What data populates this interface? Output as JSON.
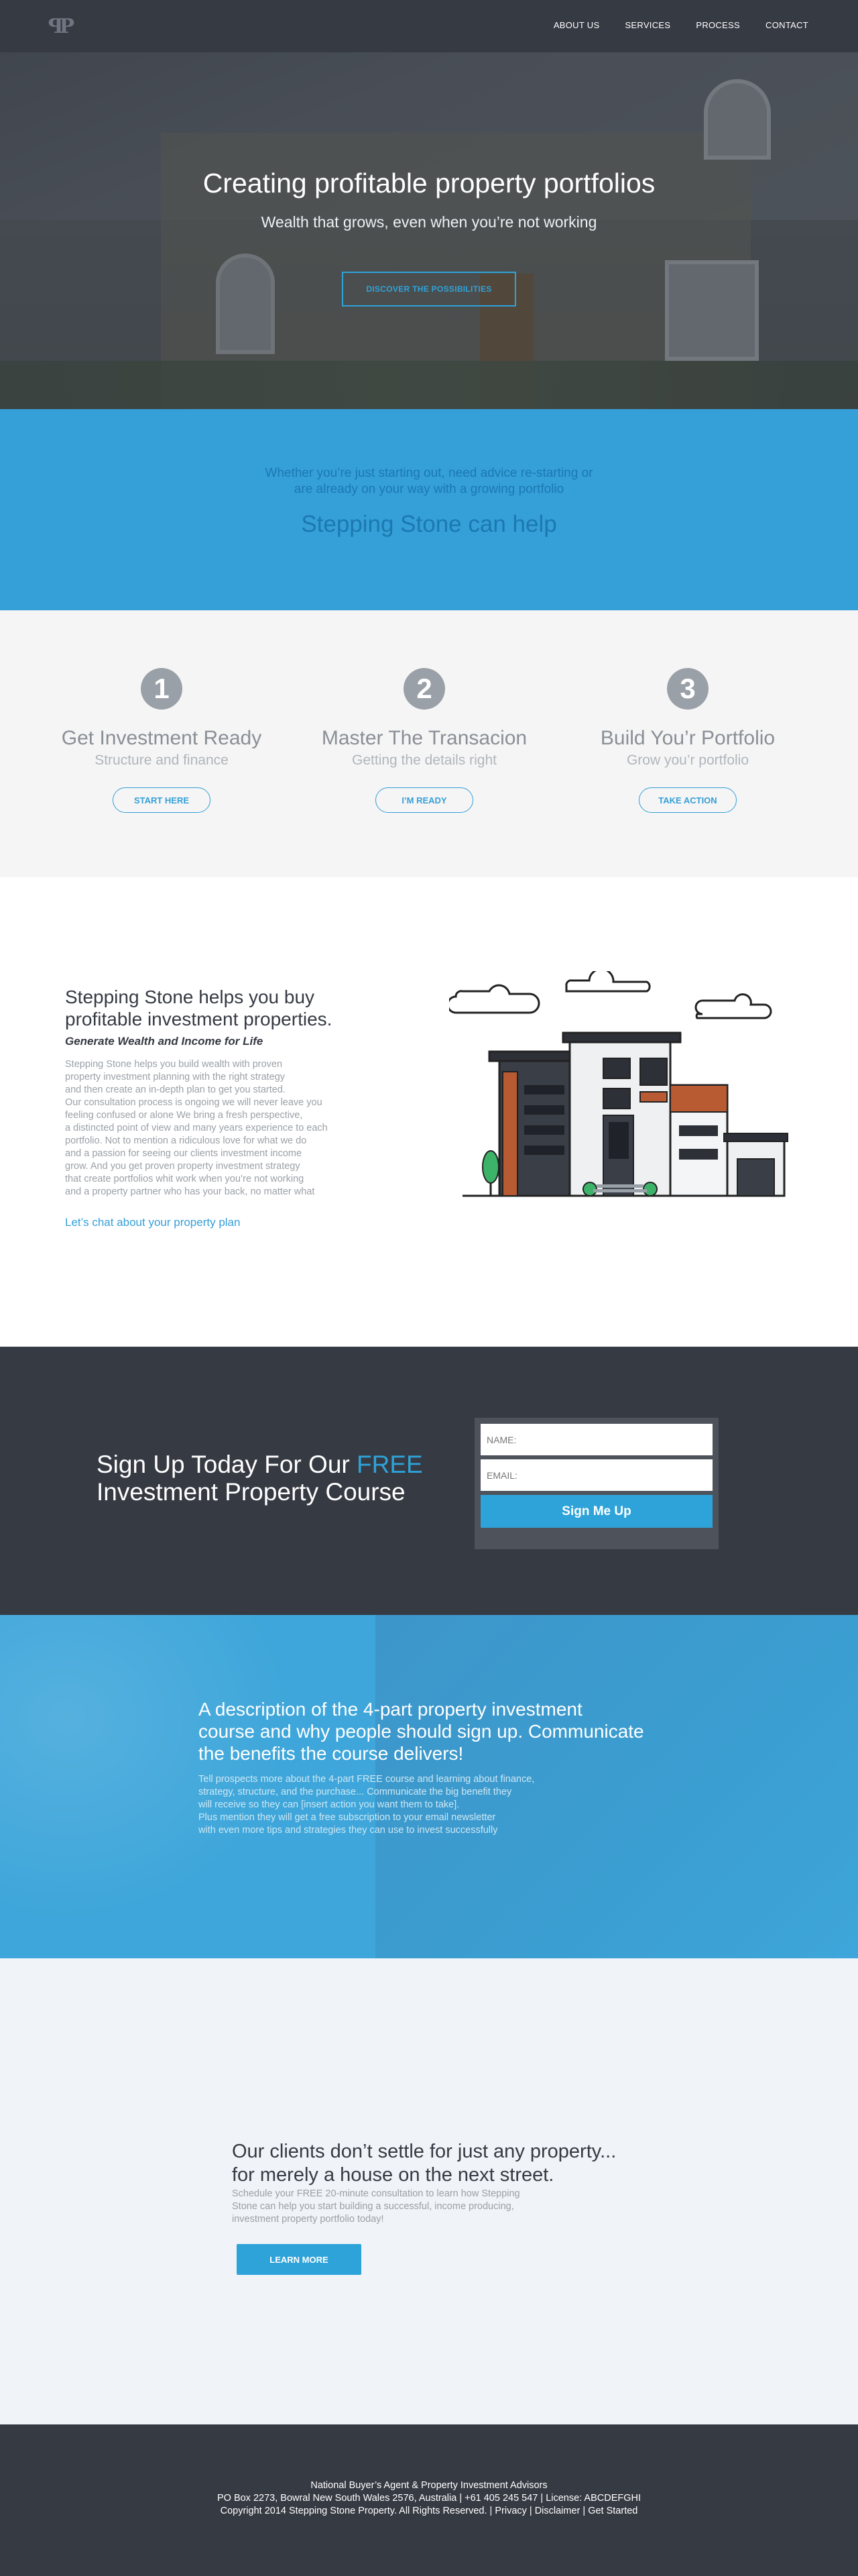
{
  "nav": {
    "logo": "ꟼP",
    "items": [
      "ABOUT US",
      "SERVICES",
      "PROCESS",
      "CONTACT"
    ]
  },
  "hero": {
    "title": "Creating profitable property portfolios",
    "subtitle": "Wealth that grows, even when you’re not working",
    "cta": "DISCOVER THE POSSIBILITIES"
  },
  "band": {
    "line1": "Whether you’re just starting out, need advice re-starting or",
    "line2": "are already on your way with a growing portfolio",
    "heading": "Stepping Stone can help"
  },
  "steps": [
    {
      "number": "1",
      "title": "Get Investment Ready",
      "subtitle": "Structure and finance",
      "button": "START HERE"
    },
    {
      "number": "2",
      "title": "Master The Transacion",
      "subtitle": "Getting the details right",
      "button": "I’M READY"
    },
    {
      "number": "3",
      "title": "Build You’r Portfolio",
      "subtitle": "Grow you’r portfolio",
      "button": "TAKE ACTION"
    }
  ],
  "about": {
    "heading_line1": "Stepping Stone helps you buy",
    "heading_line2": "profitable investment properties.",
    "subheading": "Generate Wealth and Income for Life",
    "body": [
      "Stepping Stone helps you build wealth with proven",
      "property investment planning with the right strategy",
      "and then create an in-depth plan to get you started.",
      "Our consultation process is ongoing we will never leave you",
      "feeling confused or alone We bring a fresh perspective,",
      "a distincted point of view and many years experience to each",
      "portfolio. Not to mention a ridiculous love for what  we do",
      "and a passion for seeing our clients  investment income",
      "grow. And you get proven property investment strategy",
      "that create portfolios whit work when you’re not working",
      "and a property partner who has your back, no matter what"
    ],
    "link": "Let’s chat about your property plan"
  },
  "signup": {
    "heading_line1_pre": "Sign Up Today For Our ",
    "heading_line1_free": "FREE",
    "heading_line2": "Investment Property Course",
    "name_placeholder": "NAME:",
    "email_placeholder": "EMAIL:",
    "button": "Sign Me Up"
  },
  "description": {
    "heading": [
      "A description of the 4-part property investment",
      "course  and why people should sign up. Communicate",
      "the benefits the course delivers!"
    ],
    "body": [
      "Tell prospects more about the 4-part FREE course and learning about finance,",
      "strategy, structure, and the purchase... Communicate the big benefit they",
      "will receive so they can [insert action you want them to take].",
      "Plus mention they will get a free subscription to your email newsletter",
      "with even more tips and strategies they can use to invest successfully"
    ]
  },
  "clients": {
    "heading_line1": "Our clients don’t settle for just any property...",
    "heading_line2": "for merely a house on the next street.",
    "body": [
      "Schedule your FREE 20-minute consultation to learn how Stepping",
      "Stone can help you start building a successful, income producing,",
      "investment property portfolio today!"
    ],
    "button": "LEARN MORE"
  },
  "footer": {
    "line1": "National Buyer’s Agent & Property Investment Advisors",
    "line2": "PO Box 2273, Bowral New South Wales 2576, Australia  |  +61 405 245 547  |  License: ABCDEFGHI",
    "line3": "Copyright 2014 Stepping Stone Property. All Rights Reserved.  |  Privacy  |  Disclaimer  |  Get Started"
  }
}
